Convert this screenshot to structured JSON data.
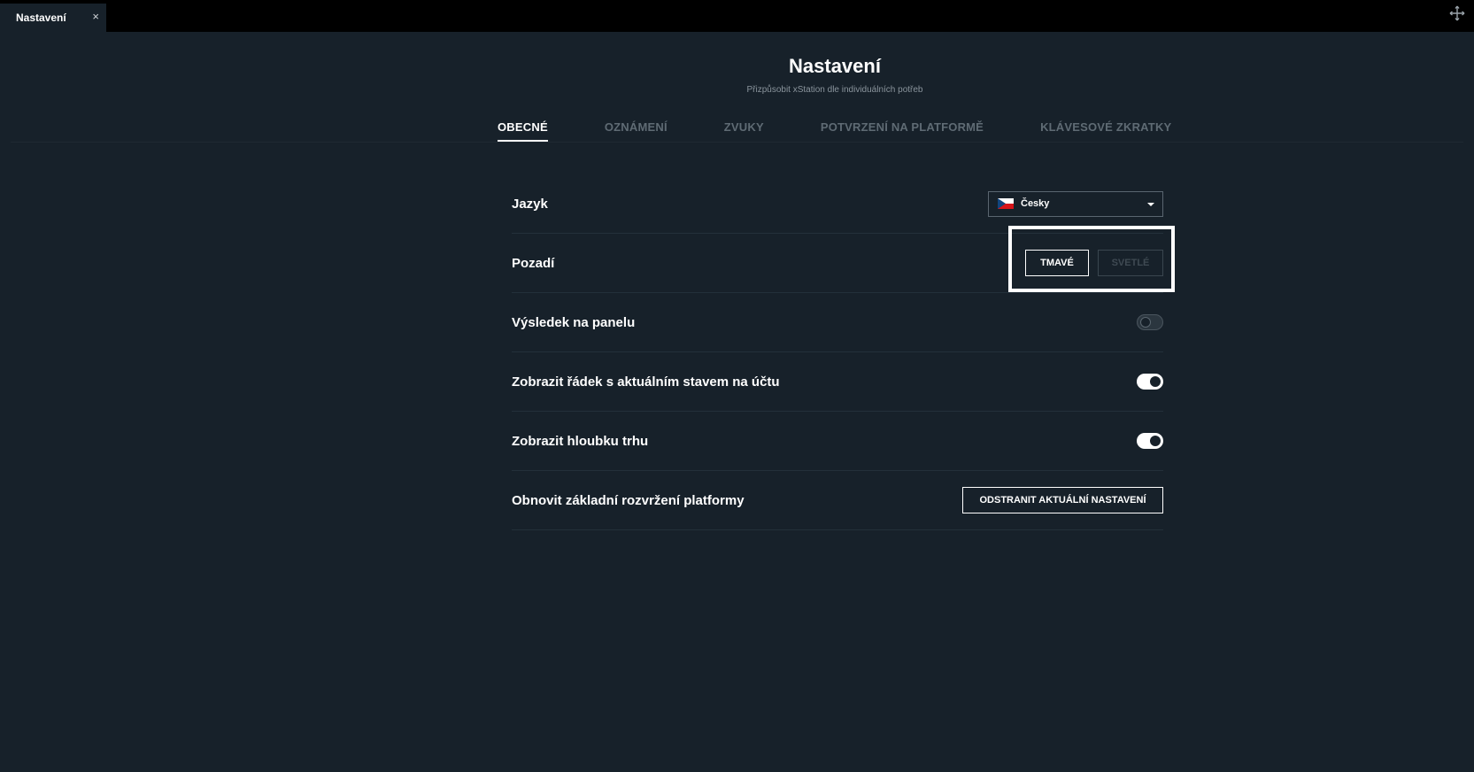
{
  "window": {
    "tab_label": "Nastavení",
    "tab_close": "×",
    "corner_icon": "move-icon"
  },
  "header": {
    "title": "Nastavení",
    "subtitle": "Přizpůsobit xStation dle individuálních potřeb"
  },
  "tabs": [
    {
      "label": "OBECNÉ",
      "active": true
    },
    {
      "label": "OZNÁMENÍ",
      "active": false
    },
    {
      "label": "ZVUKY",
      "active": false
    },
    {
      "label": "POTVRZENÍ NA PLATFORMĚ",
      "active": false
    },
    {
      "label": "KLÁVESOVÉ ZKRATKY",
      "active": false
    }
  ],
  "settings": {
    "language": {
      "label": "Jazyk",
      "value": "Česky"
    },
    "background": {
      "label": "Pozadí",
      "dark_label": "TMAVÉ",
      "light_label": "SVETLÉ",
      "selected": "dark"
    },
    "panel_result": {
      "label": "Výsledek na panelu",
      "enabled": false
    },
    "account_status_row": {
      "label": "Zobrazit řádek s aktuálním stavem na účtu",
      "enabled": true
    },
    "market_depth": {
      "label": "Zobrazit hloubku trhu",
      "enabled": true
    },
    "reset_layout": {
      "label": "Obnovit základní rozvržení platformy",
      "button_label": "ODSTRANIT AKTUÁLNÍ NASTAVENÍ"
    }
  },
  "colors": {
    "background": "#17212a",
    "topbar": "#000000",
    "accent": "#ffffff"
  }
}
